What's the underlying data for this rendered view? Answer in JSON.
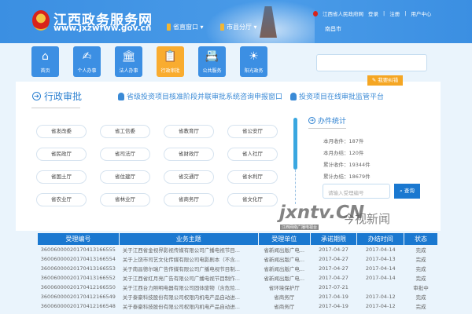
{
  "header": {
    "title": "江西政务服务网",
    "url": "www.jxzwfww.gov.cn",
    "links": [
      {
        "label": "省直窗口 ▾"
      },
      {
        "label": "市县分厅 ▾"
      }
    ],
    "gov_link": "江西省人民政府网",
    "login": "登录",
    "register": "注册",
    "user_center": "用户中心",
    "city": "南昌市"
  },
  "nav": [
    {
      "label": "首页",
      "icon": "⌂"
    },
    {
      "label": "个人办事",
      "icon": "✍"
    },
    {
      "label": "法人办事",
      "icon": "🏛"
    },
    {
      "label": "行政审批",
      "icon": "📋"
    },
    {
      "label": "公共服务",
      "icon": "📇"
    },
    {
      "label": "阳光政务",
      "icon": "☀"
    }
  ],
  "feedback": "✎ 我要纠错",
  "section": {
    "title": "行政审批",
    "link1": "省级投资项目核准阶段并联审批系统咨询申报窗口",
    "link2": "投资项目在线审批监管平台"
  },
  "departments": [
    "省发改委",
    "省工信委",
    "省教育厅",
    "省公安厅",
    "省民政厅",
    "省司法厅",
    "省财政厅",
    "省人社厅",
    "省国土厅",
    "省住建厅",
    "省交通厅",
    "省水利厅",
    "省农业厅",
    "省林业厅",
    "省商务厅",
    "省文化厅"
  ],
  "stats": {
    "title": "办件统计",
    "month_received": "本月收件：187件",
    "month_done": "本月办结：120件",
    "total_received": "累计收件：19344件",
    "total_done": "累计办结：18679件",
    "placeholder": "请输入受理编号",
    "query": "查询"
  },
  "table": {
    "headers": [
      "受理编号",
      "业务主题",
      "受理单位",
      "承诺期限",
      "办结时间",
      "状态"
    ],
    "rows": [
      [
        "36006000020170413166555",
        "关于江西省金视界影视传媒有限公司广播电视节目...",
        "省新闻出版广电...",
        "2017-04-27",
        "2017-04-14",
        "完成"
      ],
      [
        "36006000020170413166554",
        "关于上饶市司艺文化传媒有限公司电影剧本（不含...",
        "省新闻出版广电...",
        "2017-04-27",
        "2017-04-13",
        "完成"
      ],
      [
        "36006000020170413166553",
        "关于南昌德尔瑞广告传媒有限公司广播电视节目制...",
        "省新闻出版广电...",
        "2017-04-27",
        "2017-04-14",
        "完成"
      ],
      [
        "36006000020170413166552",
        "关于江西省红月亮广告有限公司广播电视节目制作...",
        "省新闻出版广电...",
        "2017-04-27",
        "2017-04-14",
        "完成"
      ],
      [
        "36006000020170412166550",
        "关于江西台力照明电器有限公司固体废物（含危险...",
        "省环境保护厅",
        "2017-07-21",
        "",
        "审批中"
      ],
      [
        "36006000020170412166549",
        "关于泰豪科技股份有限公司权限内机电产品自动进...",
        "省商务厅",
        "2017-04-19",
        "2017-04-12",
        "完成"
      ],
      [
        "36006000020170412166548",
        "关于泰豪科技股份有限公司权限内机电产品自动进...",
        "省商务厅",
        "2017-04-19",
        "2017-04-12",
        "完成"
      ]
    ]
  },
  "watermark": {
    "brand": "jxntv.CN",
    "name": "今视新闻",
    "sub": "江西网络广播电视台"
  },
  "colors": {
    "header": "#3b8fe2",
    "accent": "#1a78d0",
    "active": "#f9ac2f"
  }
}
